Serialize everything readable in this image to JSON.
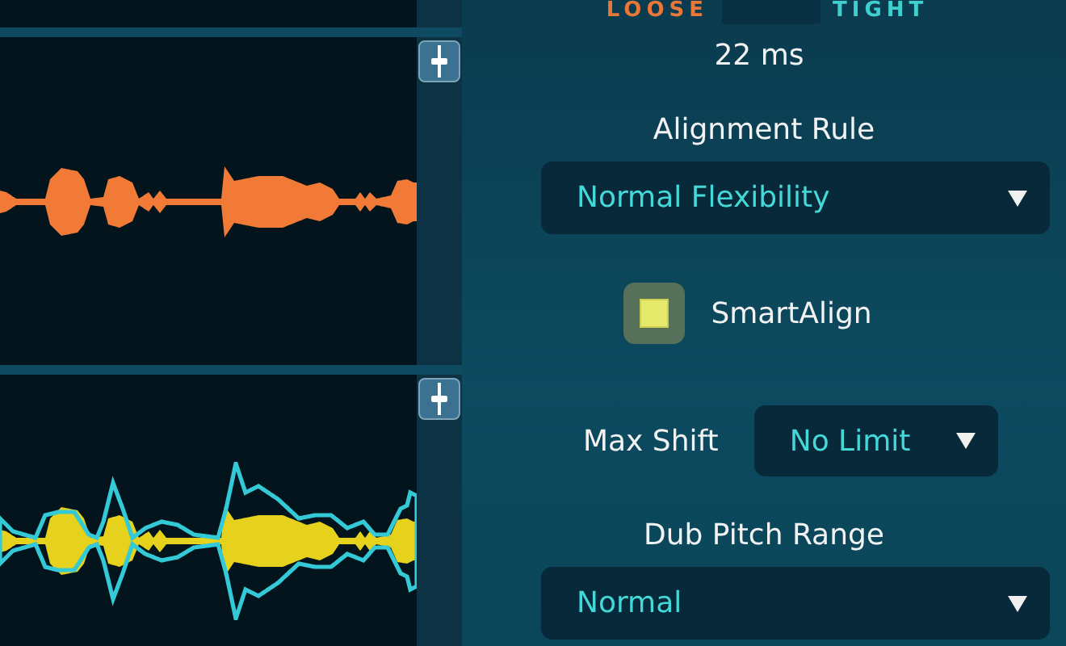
{
  "tracks": [
    {
      "kind": "guide"
    },
    {
      "kind": "dub"
    }
  ],
  "tightness": {
    "loose_label": "LOOSE",
    "tight_label": "TIGHT",
    "reading": "22 ms"
  },
  "alignment_rule": {
    "label": "Alignment Rule",
    "value": "Normal Flexibility"
  },
  "smart_align": {
    "label": "SmartAlign",
    "checked": true
  },
  "max_shift": {
    "label": "Max Shift",
    "value": "No Limit"
  },
  "dub_pitch_range": {
    "label": "Dub Pitch Range",
    "value": "Normal"
  }
}
